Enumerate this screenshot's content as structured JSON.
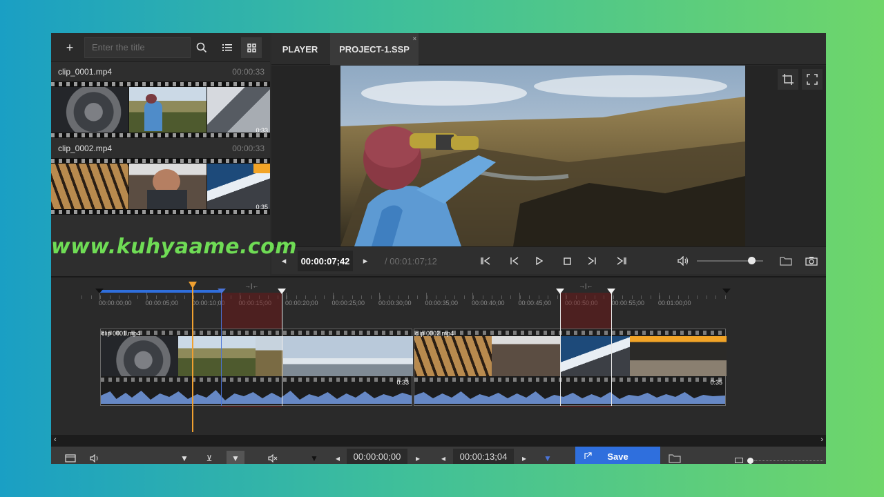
{
  "library": {
    "search_placeholder": "Enter the title",
    "add_icon": "+",
    "search_icon": "search-icon",
    "list_view_icon": "list-icon",
    "grid_view_icon": "grid-icon",
    "clips": [
      {
        "name": "clip_0001.mp4",
        "duration": "00:00:33",
        "strip_time": "0:33"
      },
      {
        "name": "clip_0002.mp4",
        "duration": "00:00:33",
        "strip_time": "0:35"
      }
    ]
  },
  "watermark": "www.kuhyaame.com",
  "tabs": [
    {
      "label": "PLAYER",
      "active": false
    },
    {
      "label": "PROJECT-1.SSP",
      "active": true,
      "close": "×"
    }
  ],
  "player": {
    "current_time": "00:00:07;42",
    "total_time": "/ 00:01:07;12",
    "volume": 0.82
  },
  "timeline": {
    "ruler_labels": [
      "00:00:00;00",
      "00:00:05;00",
      "00:00:10;00",
      "00:00:15;00",
      "00:00:20;00",
      "00:00:25;00",
      "00:00:30;00",
      "00:00:35;00",
      "00:00:40;00",
      "00:00:45;00",
      "00:00:50;00",
      "00:00:55;00",
      "00:01:00;00"
    ],
    "gap_marker": "→|←",
    "tracks": [
      {
        "name": "clip 0001.mp4",
        "end_time": "0:33"
      },
      {
        "name": "clip 0002.mp4",
        "end_time": "0:35"
      }
    ]
  },
  "bottom_bar": {
    "in_time": "00:00:00;00",
    "out_time": "00:00:13;04",
    "save_label": "Save"
  },
  "colors": {
    "accent_blue": "#2f6fdd",
    "playhead": "#f0a030",
    "cut_region": "#781414",
    "waveform": "#6f95d8",
    "watermark": "#6fdc55"
  }
}
